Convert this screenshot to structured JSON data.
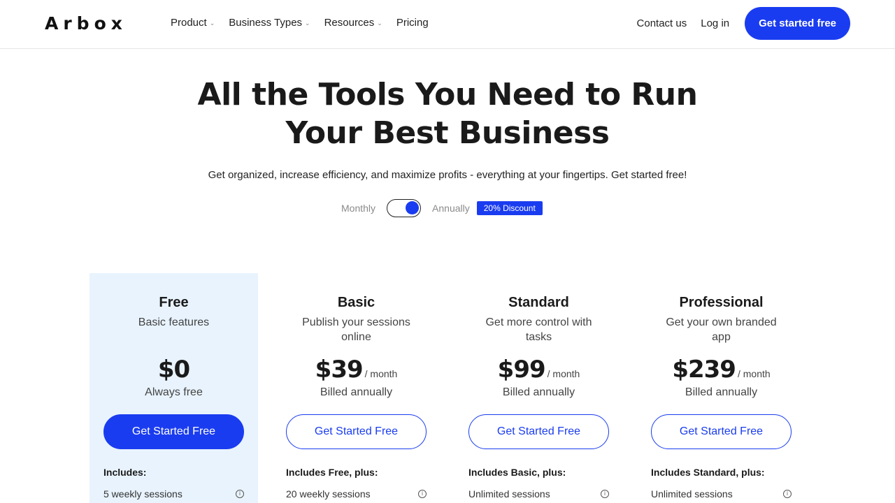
{
  "header": {
    "logo": "Arbox",
    "nav": [
      {
        "label": "Product",
        "dropdown": true
      },
      {
        "label": "Business Types",
        "dropdown": true
      },
      {
        "label": "Resources",
        "dropdown": true
      },
      {
        "label": "Pricing",
        "dropdown": false
      }
    ],
    "contact": "Contact us",
    "login": "Log in",
    "cta": "Get started free"
  },
  "hero": {
    "title_line1": "All the Tools You Need to Run",
    "title_line2": "Your Best Business",
    "subtitle": "Get organized, increase efficiency, and maximize profits - everything at your fingertips. Get started free!"
  },
  "billing": {
    "monthly": "Monthly",
    "annually": "Annually",
    "selected": "Annually",
    "discount": "20% Discount"
  },
  "plans": [
    {
      "name": "Free",
      "desc": "Basic features",
      "price": "$0",
      "per": "",
      "billed": "Always free",
      "button": "Get Started Free",
      "includes": "Includes:",
      "feature": "5 weekly sessions"
    },
    {
      "name": "Basic",
      "desc": "Publish your sessions online",
      "price": "$39",
      "per": "/ month",
      "billed": "Billed annually",
      "button": "Get Started Free",
      "includes": "Includes Free, plus:",
      "feature": "20 weekly sessions"
    },
    {
      "name": "Standard",
      "desc": "Get more control with tasks",
      "price": "$99",
      "per": "/ month",
      "billed": "Billed annually",
      "button": "Get Started Free",
      "includes": "Includes Basic, plus:",
      "feature": "Unlimited sessions"
    },
    {
      "name": "Professional",
      "desc": "Get your own branded app",
      "price": "$239",
      "per": "/ month",
      "billed": "Billed annually",
      "button": "Get Started Free",
      "includes": "Includes Standard, plus:",
      "feature": "Unlimited sessions"
    }
  ],
  "colors": {
    "accent": "#1a3cf0",
    "featured_bg": "#e8f3fd"
  }
}
